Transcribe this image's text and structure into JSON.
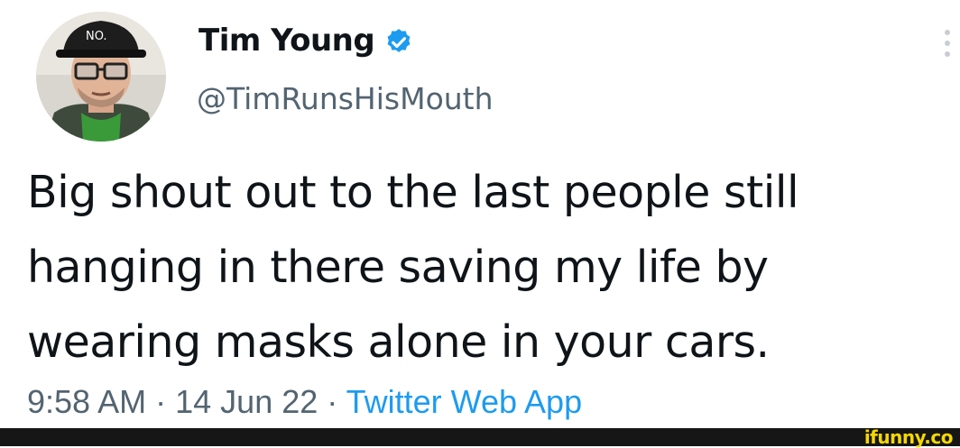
{
  "tweet": {
    "author": {
      "display_name": "Tim Young",
      "handle": "@TimRunsHisMouth",
      "verified": true,
      "avatar_icon": "person-avatar-icon",
      "hat_text": "NO."
    },
    "text_lines": [
      "Big shout out to the last people still",
      "hanging in there saving my life by",
      "wearing masks alone in your cars."
    ],
    "meta": {
      "time": "9:58 AM",
      "separator": "·",
      "date": "14 Jun 22",
      "source": "Twitter Web App"
    }
  },
  "watermark": {
    "text": "ifunny.co"
  },
  "colors": {
    "text": "#0f1419",
    "secondary": "#536471",
    "link": "#1d9bf0",
    "verified_badge": "#1d9bf0",
    "footer": "#161616",
    "watermark": "#f5d800"
  }
}
